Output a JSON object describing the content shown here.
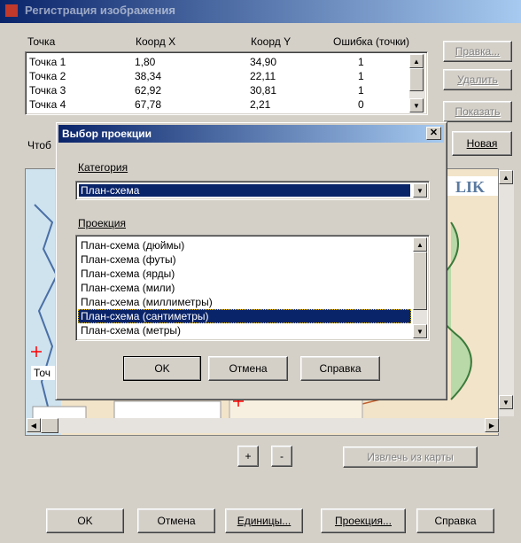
{
  "window": {
    "title": "Регистрация изображения"
  },
  "points_table": {
    "headers": [
      "Точка",
      "Коорд X",
      "Коорд Y",
      "Ошибка (точки)"
    ],
    "rows": [
      [
        "Точка 1",
        "1,80",
        "34,90",
        "1"
      ],
      [
        "Точка 2",
        "38,34",
        "22,11",
        "1"
      ],
      [
        "Точка 3",
        "62,92",
        "30,81",
        "1"
      ],
      [
        "Точка 4",
        "67,78",
        "2,21",
        "0"
      ]
    ]
  },
  "side_buttons": {
    "edit": "Правка...",
    "delete": "Удалить",
    "show": "Показать",
    "new": "Новая"
  },
  "hint_text": "Чтоб",
  "map": {
    "brand_text": "LIK",
    "marker_label": "Точ"
  },
  "dialog": {
    "title": "Выбор проекции",
    "category_label": "Категория",
    "category_value": "План-схема",
    "projection_label": "Проекция",
    "projections": [
      "План-схема (дюймы)",
      "План-схема (футы)",
      "План-схема (ярды)",
      "План-схема (мили)",
      "План-схема (миллиметры)",
      "План-схема (сантиметры)",
      "План-схема (метры)"
    ],
    "selected_index": 5,
    "ok": "OK",
    "cancel": "Отмена",
    "help": "Справка"
  },
  "zoom": {
    "plus": "+",
    "minus": "-"
  },
  "extract_button": "Извлечь из карты",
  "bottom_buttons": {
    "ok": "OK",
    "cancel": "Отмена",
    "units": "Единицы...",
    "projection": "Проекция...",
    "help": "Справка"
  }
}
